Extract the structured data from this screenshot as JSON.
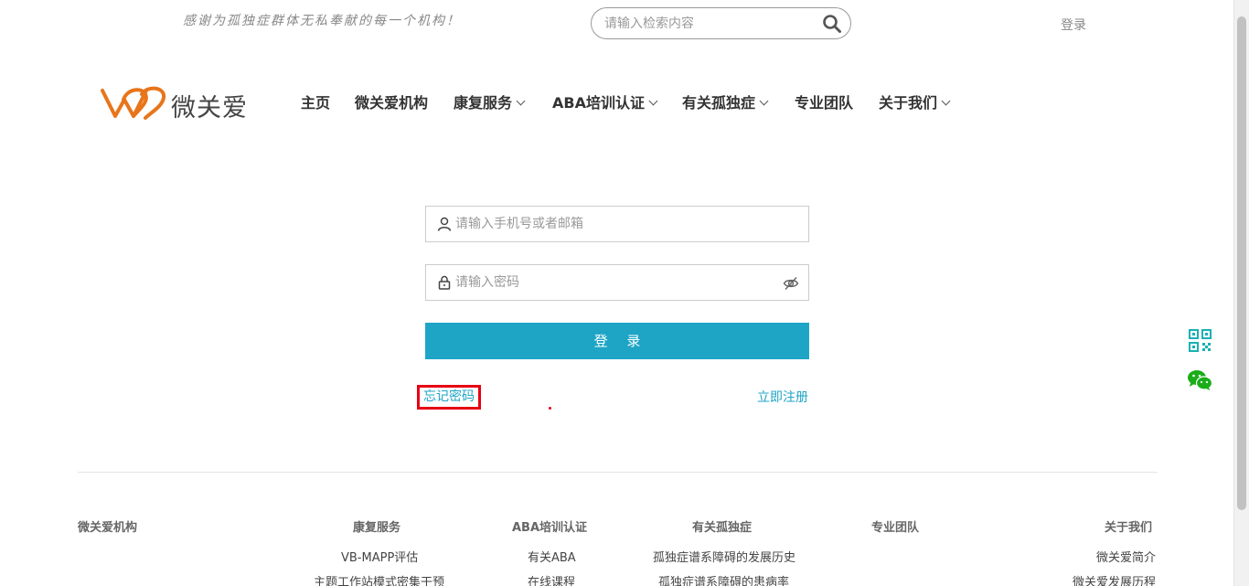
{
  "top": {
    "slogan": "感谢为孤独症群体无私奉献的每一个机构！",
    "search_placeholder": "请输入检索内容",
    "login_label": "登录"
  },
  "brand": {
    "name": "微关爱",
    "accent": "#e8751a"
  },
  "nav": {
    "items": [
      {
        "label": "主页",
        "has_dropdown": false
      },
      {
        "label": "微关爱机构",
        "has_dropdown": false
      },
      {
        "label": "康复服务",
        "has_dropdown": true
      },
      {
        "label": "ABA培训认证",
        "has_dropdown": true
      },
      {
        "label": "有关孤独症",
        "has_dropdown": true
      },
      {
        "label": "专业团队",
        "has_dropdown": false
      },
      {
        "label": "关于我们",
        "has_dropdown": true
      }
    ]
  },
  "login_form": {
    "account_placeholder": "请输入手机号或者邮箱",
    "password_placeholder": "请输入密码",
    "submit_label": "登 录",
    "forgot_label": "忘记密码",
    "register_label": "立即注册",
    "primary_color": "#1ea5c6",
    "highlight_color": "#e60012"
  },
  "side": {
    "qr_icon": "qr-code-icon",
    "wechat_icon": "wechat-icon"
  },
  "footer": {
    "columns": [
      {
        "title": "微关爱机构",
        "links": []
      },
      {
        "title": "康复服务",
        "links": [
          "VB-MAPP评估",
          "主题工作站模式密集干预"
        ]
      },
      {
        "title": "ABA培训认证",
        "links": [
          "有关ABA",
          "在线课程"
        ]
      },
      {
        "title": "有关孤独症",
        "links": [
          "孤独症谱系障碍的发展历史",
          "孤独症谱系障碍的患病率"
        ]
      },
      {
        "title": "专业团队",
        "links": []
      },
      {
        "title": "关于我们",
        "links": [
          "微关爱简介",
          "微关爱发展历程"
        ]
      }
    ]
  }
}
